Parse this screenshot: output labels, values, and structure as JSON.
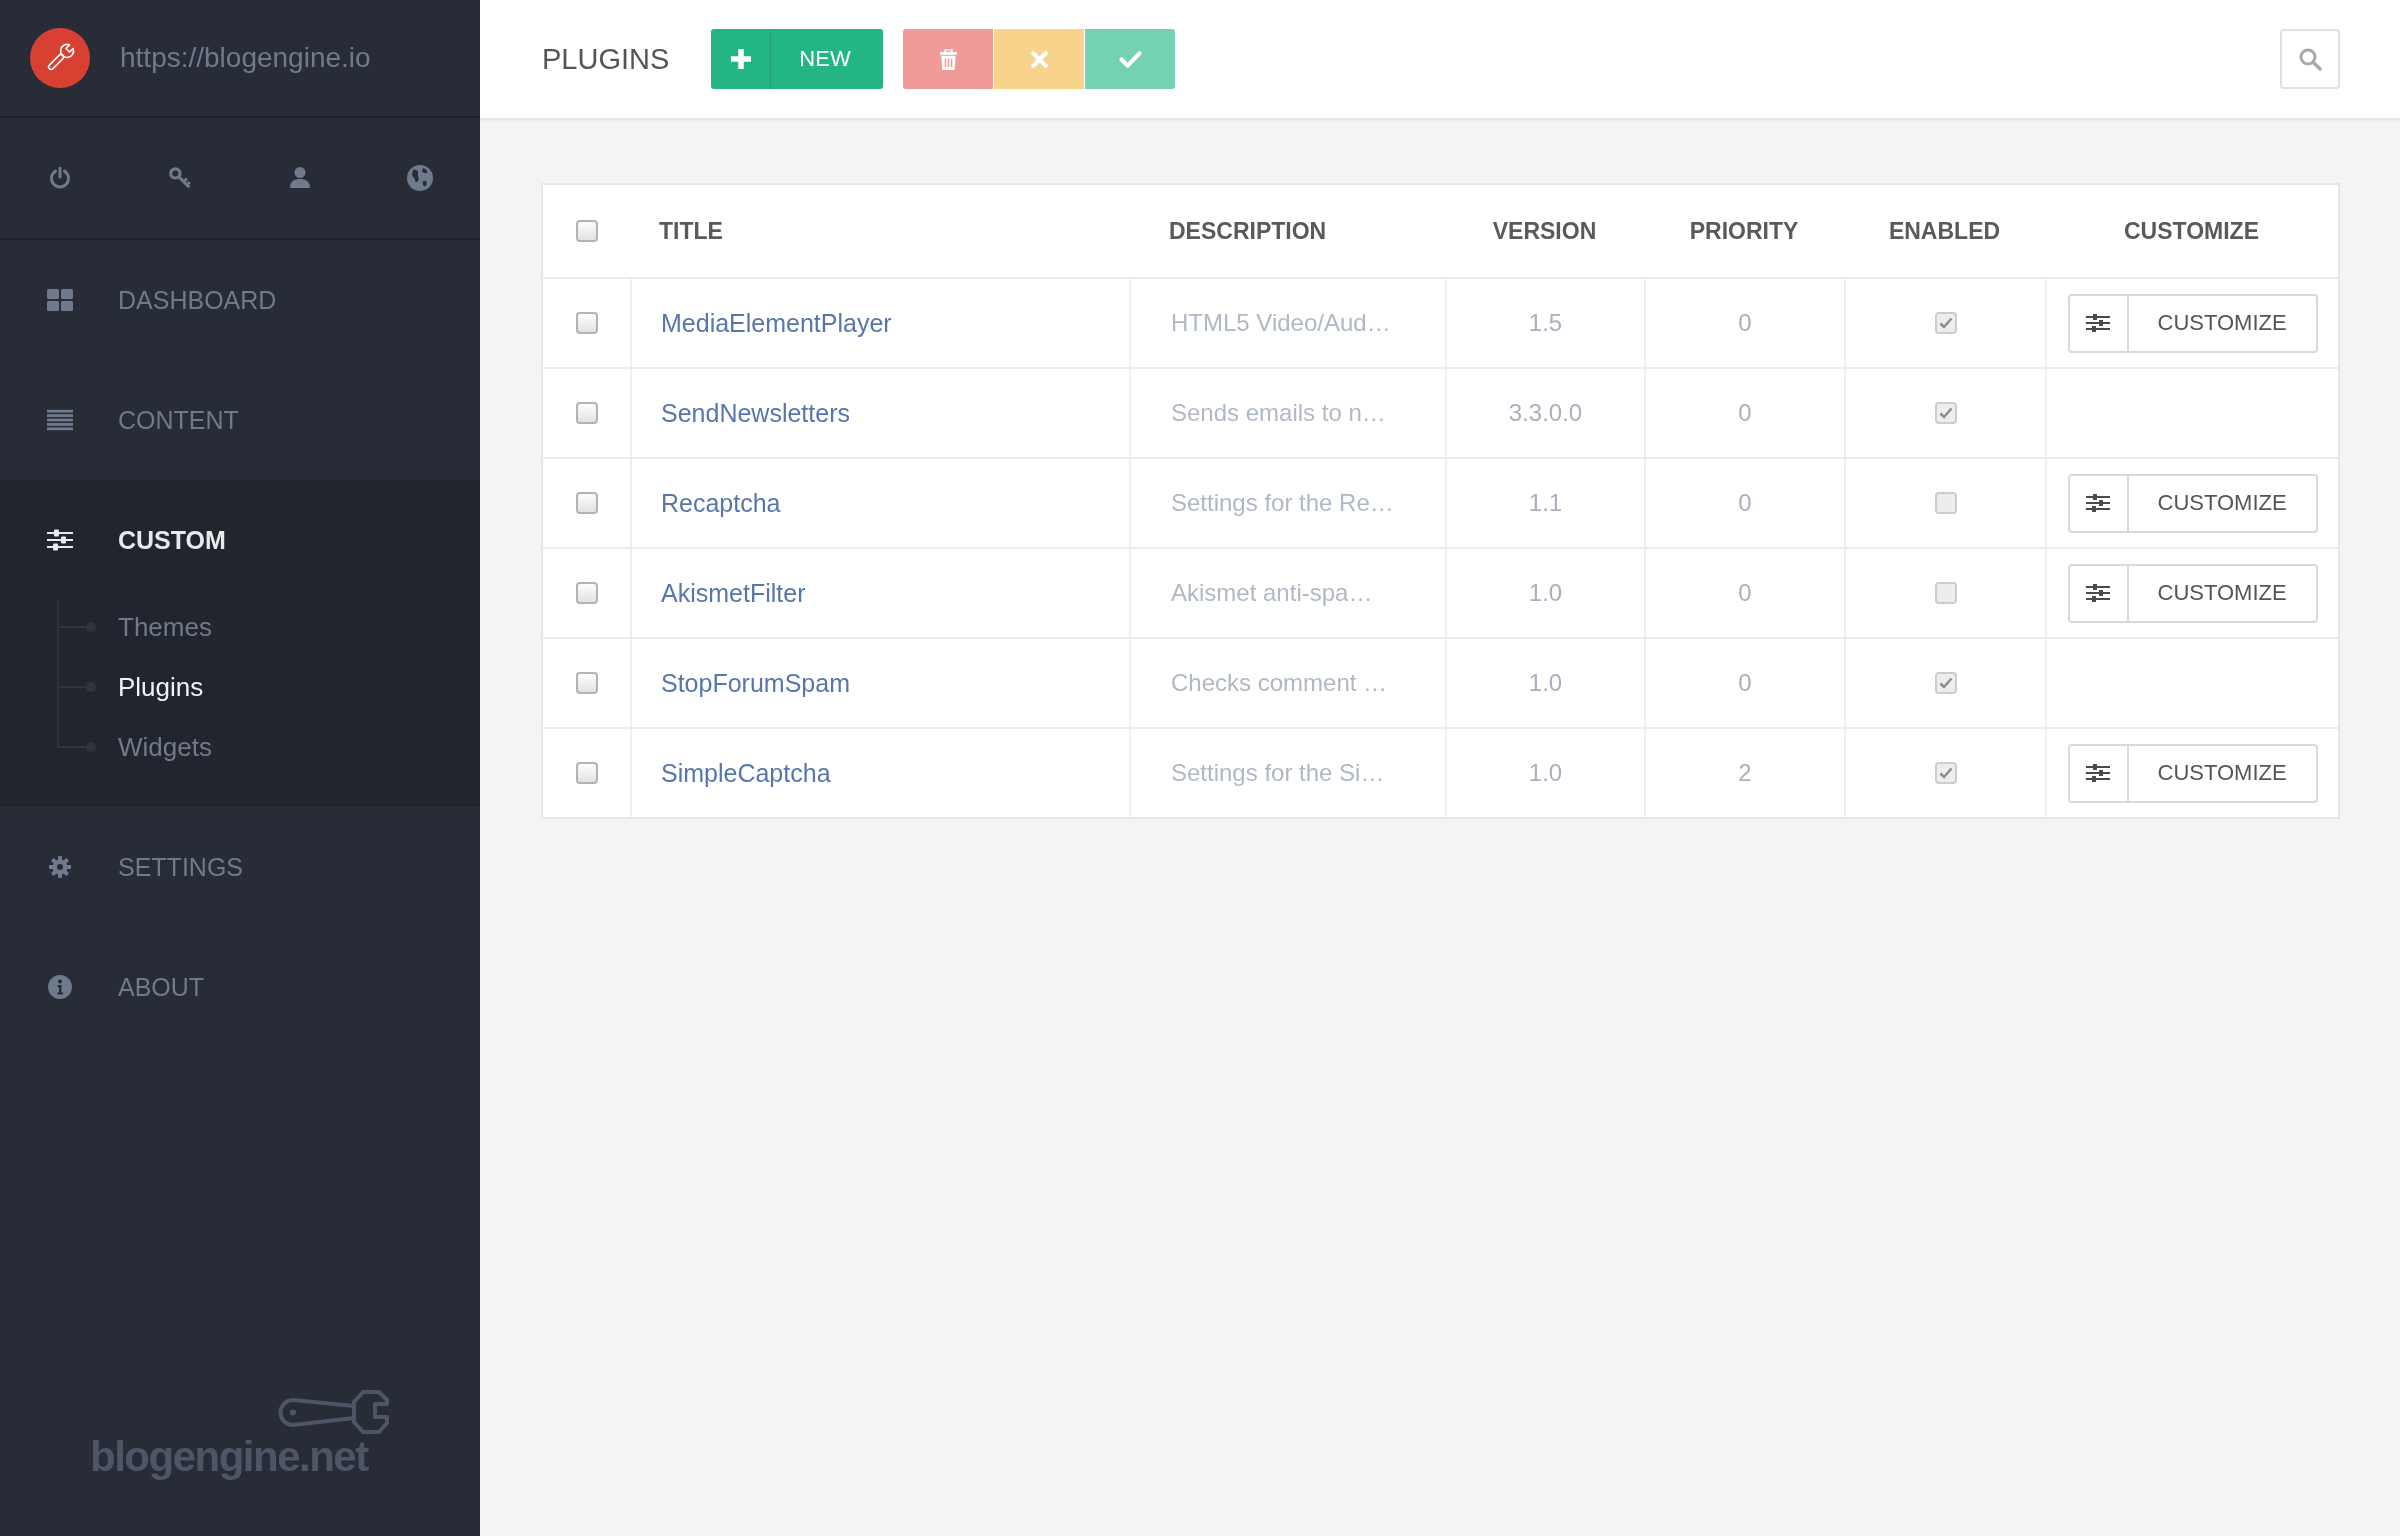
{
  "sidebar": {
    "site_url": "https://blogengine.io",
    "nav": [
      {
        "label": "DASHBOARD",
        "selected": false
      },
      {
        "label": "CONTENT",
        "selected": false
      },
      {
        "label": "CUSTOM",
        "selected": true,
        "children": [
          {
            "label": "Themes",
            "selected": false
          },
          {
            "label": "Plugins",
            "selected": true
          },
          {
            "label": "Widgets",
            "selected": false
          }
        ]
      },
      {
        "label": "SETTINGS",
        "selected": false
      },
      {
        "label": "ABOUT",
        "selected": false
      }
    ],
    "logo_text": "blogengine.net"
  },
  "toolbar": {
    "title": "PLUGINS",
    "new_button": "NEW"
  },
  "table": {
    "all_checked": false,
    "columns": [
      "TITLE",
      "DESCRIPTION",
      "VERSION",
      "PRIORITY",
      "ENABLED",
      "CUSTOMIZE"
    ],
    "rows": [
      {
        "checked": false,
        "title": "MediaElementPlayer",
        "description": "HTML5 Video/Aud…",
        "version": "1.5",
        "priority": "0",
        "enabled": true,
        "customize": "CUSTOMIZE"
      },
      {
        "checked": false,
        "title": "SendNewsletters",
        "description": "Sends emails to n…",
        "version": "3.3.0.0",
        "priority": "0",
        "enabled": true
      },
      {
        "checked": false,
        "title": "Recaptcha",
        "description": "Settings for the Re…",
        "version": "1.1",
        "priority": "0",
        "enabled": false,
        "customize": "CUSTOMIZE"
      },
      {
        "checked": false,
        "title": "AkismetFilter",
        "description": "Akismet anti-spa…",
        "version": "1.0",
        "priority": "0",
        "enabled": false,
        "customize": "CUSTOMIZE"
      },
      {
        "checked": false,
        "title": "StopForumSpam",
        "description": "Checks comment …",
        "version": "1.0",
        "priority": "0",
        "enabled": true
      },
      {
        "checked": false,
        "title": "SimpleCaptcha",
        "description": "Settings for the Si…",
        "version": "1.0",
        "priority": "2",
        "enabled": true,
        "customize": "CUSTOMIZE"
      }
    ]
  }
}
